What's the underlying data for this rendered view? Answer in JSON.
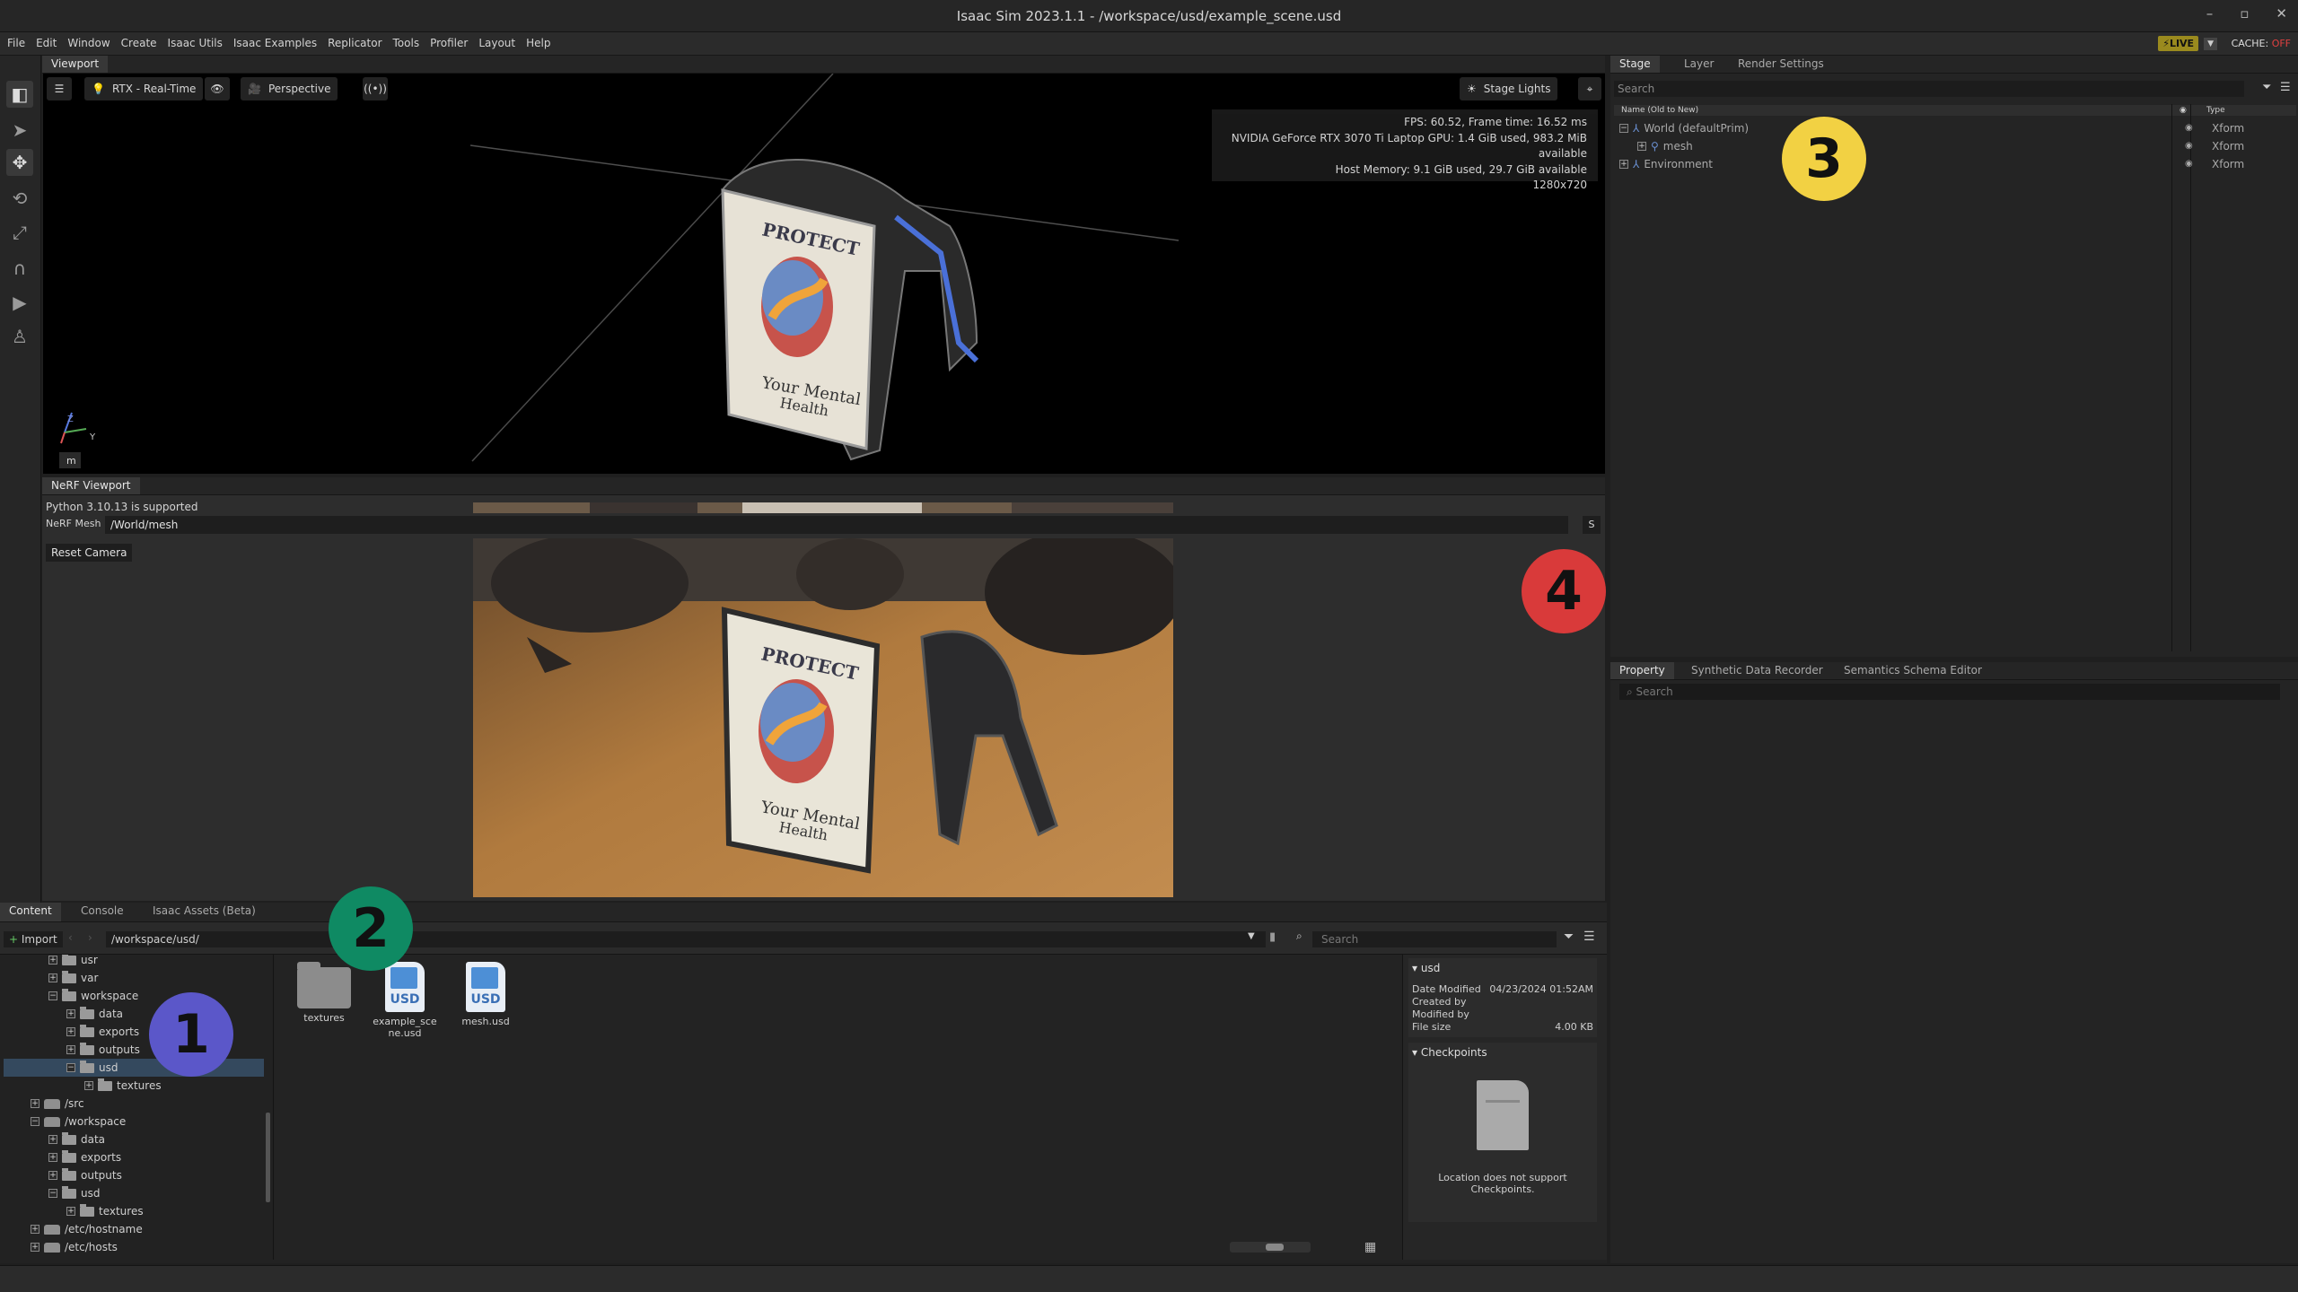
{
  "window": {
    "title": "Isaac Sim 2023.1.1 - /workspace/usd/example_scene.usd",
    "controls": [
      "–",
      "▫",
      "✕"
    ]
  },
  "menubar": {
    "items": [
      "File",
      "Edit",
      "Window",
      "Create",
      "Isaac Utils",
      "Isaac Examples",
      "Replicator",
      "Tools",
      "Profiler",
      "Layout",
      "Help"
    ],
    "live_label": "LIVE",
    "cache_label": "CACHE:",
    "cache_state": "OFF"
  },
  "viewport": {
    "tab": "Viewport",
    "renderer": "RTX - Real-Time",
    "camera": "Perspective",
    "stage_lights": "Stage Lights",
    "stats": [
      "FPS: 60.52, Frame time: 16.52 ms",
      "NVIDIA GeForce RTX 3070 Ti Laptop GPU: 1.4 GiB used, 983.2 MiB available",
      "Host Memory: 9.1 GiB used, 29.7 GiB available",
      "1280x720"
    ],
    "axis_z": "Z",
    "axis_y": "Y",
    "unit": "m",
    "poster_line1": "PROTECT",
    "poster_line2": "Your Mental",
    "poster_line3": "Health"
  },
  "nerf": {
    "tab": "NeRF Viewport",
    "python_note": "Python 3.10.13 is supported",
    "mesh_label": "NeRF Mesh",
    "mesh_value": "/World/mesh",
    "s_button": "S",
    "reset_camera": "Reset Camera"
  },
  "content": {
    "tabs": [
      "Content",
      "Console",
      "Isaac Assets (Beta)"
    ],
    "import_label": "Import",
    "path": "/workspace/usd/",
    "search_placeholder": "Search",
    "tree": [
      {
        "label": "usr",
        "depth": 2,
        "type": "folder",
        "expander": "+"
      },
      {
        "label": "var",
        "depth": 2,
        "type": "folder",
        "expander": "+"
      },
      {
        "label": "workspace",
        "depth": 2,
        "type": "folder",
        "expander": "−"
      },
      {
        "label": "data",
        "depth": 3,
        "type": "folder",
        "expander": "+"
      },
      {
        "label": "exports",
        "depth": 3,
        "type": "folder",
        "expander": "+"
      },
      {
        "label": "outputs",
        "depth": 3,
        "type": "folder",
        "expander": "+"
      },
      {
        "label": "usd",
        "depth": 3,
        "type": "folder",
        "expander": "−",
        "selected": true
      },
      {
        "label": "textures",
        "depth": 4,
        "type": "folder",
        "expander": "+"
      },
      {
        "label": "/src",
        "depth": 1,
        "type": "drive",
        "expander": "+"
      },
      {
        "label": "/workspace",
        "depth": 1,
        "type": "drive",
        "expander": "−"
      },
      {
        "label": "data",
        "depth": 2,
        "type": "folder",
        "expander": "+"
      },
      {
        "label": "exports",
        "depth": 2,
        "type": "folder",
        "expander": "+"
      },
      {
        "label": "outputs",
        "depth": 2,
        "type": "folder",
        "expander": "+"
      },
      {
        "label": "usd",
        "depth": 2,
        "type": "folder",
        "expander": "−"
      },
      {
        "label": "textures",
        "depth": 3,
        "type": "folder",
        "expander": "+"
      },
      {
        "label": "/etc/hostname",
        "depth": 1,
        "type": "drive",
        "expander": "+"
      },
      {
        "label": "/etc/hosts",
        "depth": 1,
        "type": "drive",
        "expander": "+"
      }
    ],
    "files": [
      {
        "name": "textures",
        "kind": "folder"
      },
      {
        "name": "example_scene.usd",
        "display": "example_sce\nne.usd",
        "kind": "usd"
      },
      {
        "name": "mesh.usd",
        "kind": "usd"
      }
    ],
    "usd_badge": "USD",
    "detail": {
      "header": "usd",
      "rows": [
        {
          "k": "Date Modified",
          "v": "04/23/2024 01:52AM"
        },
        {
          "k": "Created by",
          "v": ""
        },
        {
          "k": "Modified by",
          "v": ""
        },
        {
          "k": "File size",
          "v": "4.00 KB"
        }
      ],
      "checkpoints_header": "Checkpoints",
      "checkpoints_note": "Location does not support Checkpoints."
    }
  },
  "stage": {
    "tabs": [
      "Stage",
      "Layer",
      "Render Settings"
    ],
    "search_placeholder": "Search",
    "col_name": "Name (Old to New)",
    "col_type": "Type",
    "rows": [
      {
        "label": "World (defaultPrim)",
        "type": "Xform",
        "depth": 0,
        "expander": "−"
      },
      {
        "label": "mesh",
        "type": "Xform",
        "depth": 1,
        "expander": "+"
      },
      {
        "label": "Environment",
        "type": "Xform",
        "depth": 0,
        "expander": "+"
      }
    ]
  },
  "property": {
    "tabs": [
      "Property",
      "Synthetic Data Recorder",
      "Semantics Schema Editor"
    ],
    "search_placeholder": "Search"
  },
  "markers": [
    {
      "label": "1",
      "color": "#5b57c9"
    },
    {
      "label": "2",
      "color": "#0f8a63"
    },
    {
      "label": "3",
      "color": "#f2d143"
    },
    {
      "label": "4",
      "color": "#d93a3a"
    }
  ],
  "colors": {
    "accent_blue": "#34495e",
    "live": "#9a8a1e",
    "cache_off": "#e04040"
  }
}
